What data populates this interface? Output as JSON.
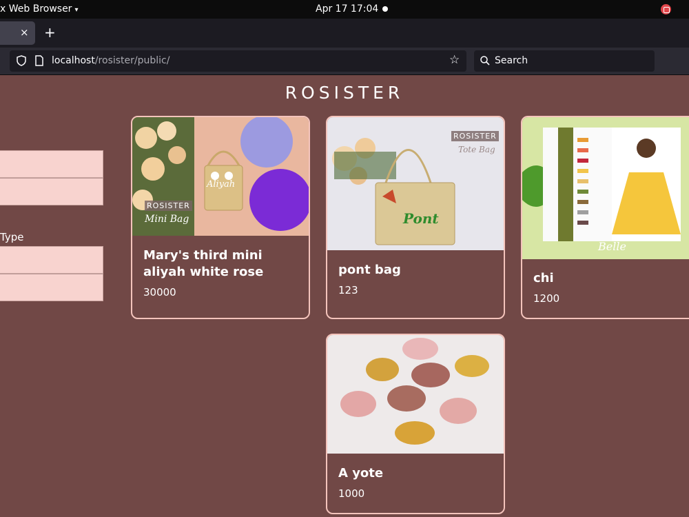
{
  "os": {
    "app_name": "x Web Browser",
    "caret": "▾",
    "clock": "Apr 17  17:04"
  },
  "browser": {
    "tab_close": "×",
    "new_tab": "+",
    "url_host": "localhost",
    "url_path": "/rosister/public/",
    "star": "☆",
    "search_placeholder": "Search"
  },
  "page": {
    "title": "ROSISTER",
    "filter_label": "Type"
  },
  "products": [
    {
      "title": "Mary's third mini aliyah white rose",
      "price": "30000",
      "image": {
        "tag": "ROSISTER",
        "script": "Mini Bag",
        "handle_text": "Aliyah"
      }
    },
    {
      "title": "pont bag",
      "price": "123",
      "image": {
        "tag": "ROSISTER",
        "script": "Tote Bag",
        "bag_text": "Pont"
      }
    },
    {
      "title": "chi",
      "price": "1200",
      "image": {
        "script": "Belle"
      }
    },
    {
      "title": "A yote",
      "price": "1000",
      "image": {}
    }
  ],
  "colors": {
    "page_bg": "#714846",
    "card_border": "#f4c4bc",
    "filter_bg": "#f8d3cf"
  }
}
